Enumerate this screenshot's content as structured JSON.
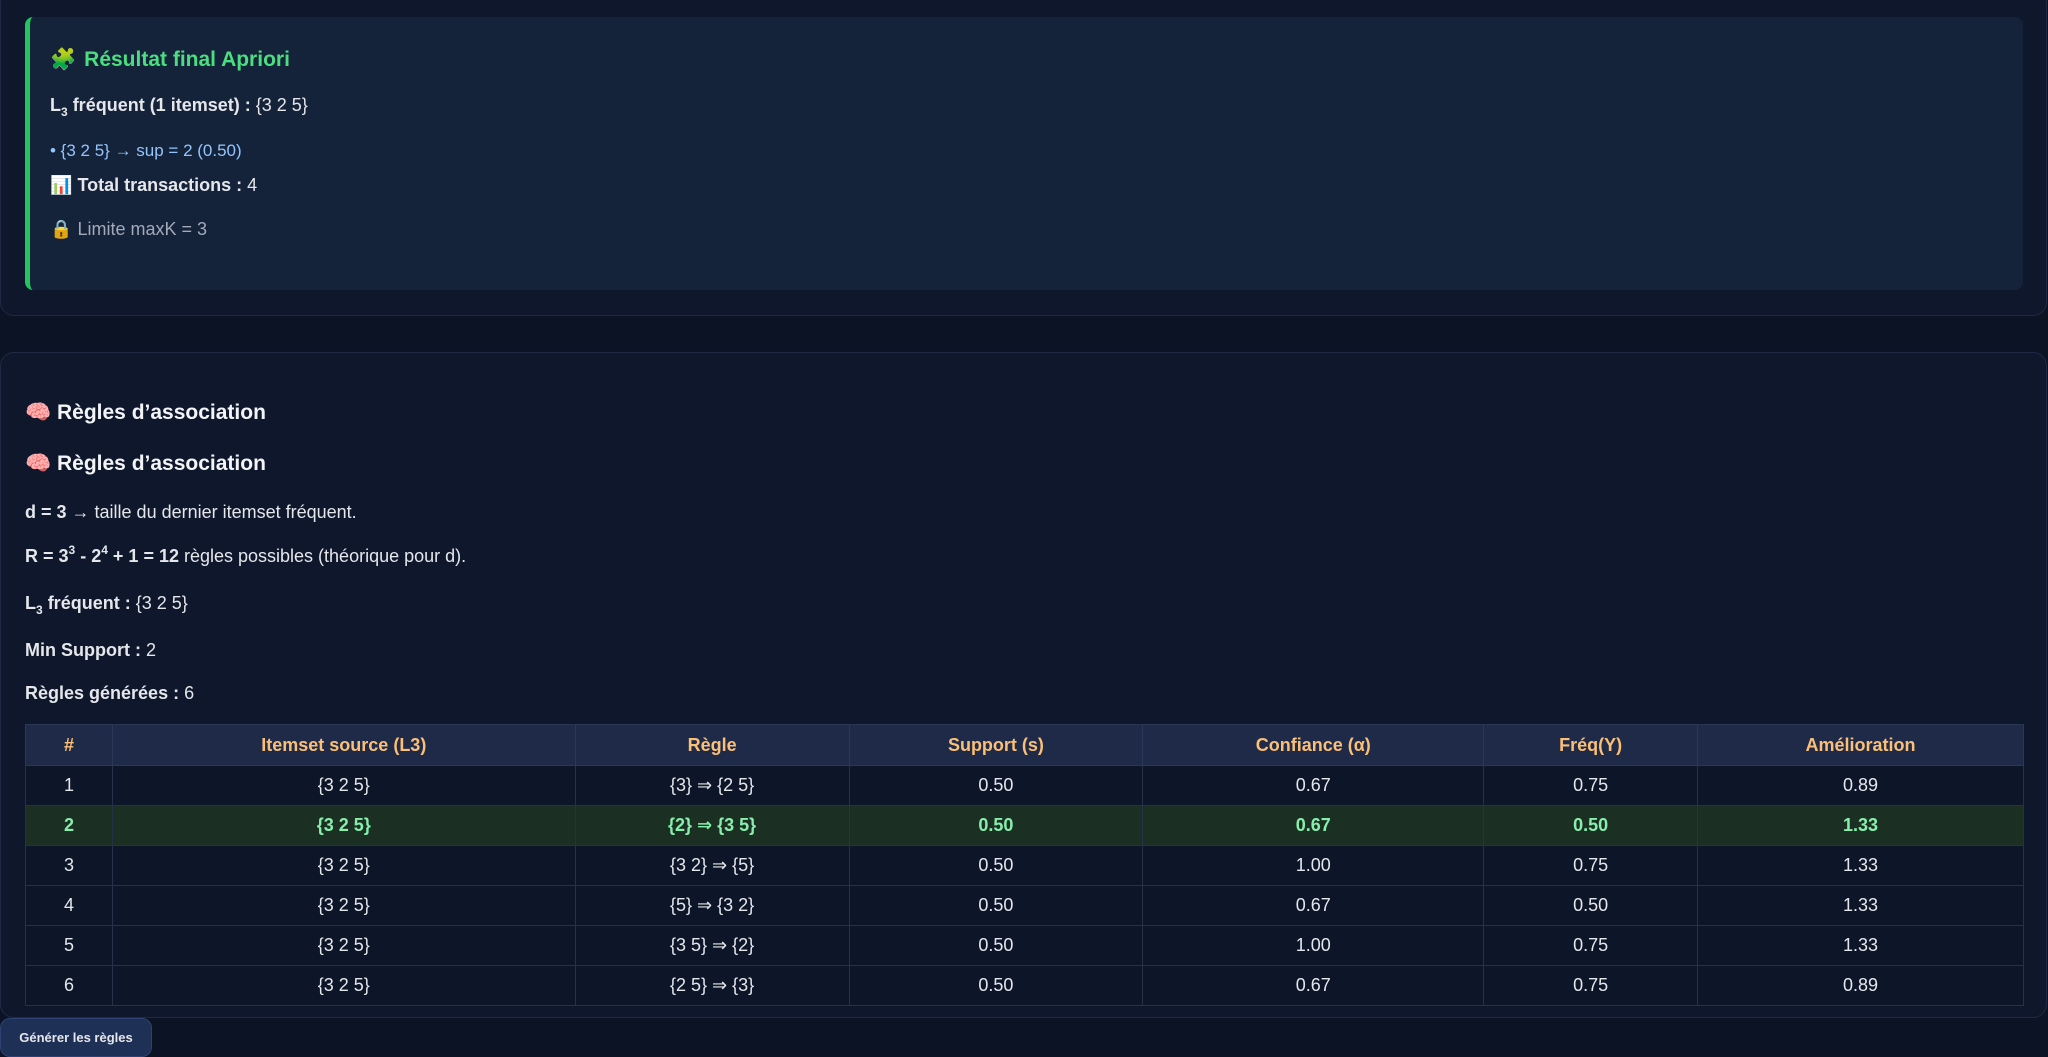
{
  "result": {
    "title_icon": "🧩",
    "title": "Résultat final Apriori",
    "l3_prefix": "L",
    "l3_sub": "3",
    "l3_label": " fréquent (1 itemset) :",
    "l3_value": " {3 2 5}",
    "bullet": "• {3 2 5} → sup = 2 (0.50)",
    "total_icon": "📊",
    "total_label": "Total transactions :",
    "total_value": " 4",
    "limit_icon": "🔒",
    "limit_text": "Limite maxK = 3"
  },
  "rules": {
    "heading_icon": "🧠",
    "heading": "Règles d’association",
    "heading2": "Règles d’association",
    "d_label": "d = 3",
    "d_text": " → taille du dernier itemset fréquent.",
    "r_label_a": "R = 3",
    "r_sup1": "3",
    "r_label_b": " - 2",
    "r_sup2": "4",
    "r_label_c": " + 1 = 12",
    "r_text": " règles possibles (théorique pour d).",
    "l3_prefix": "L",
    "l3_sub": "3",
    "l3_label": " fréquent :",
    "l3_value": " {3 2 5}",
    "minsup_label": "Min Support :",
    "minsup_value": " 2",
    "generated_label": "Règles générées :",
    "generated_value": " 6",
    "table": {
      "headers": [
        "#",
        "Itemset source (L3)",
        "Règle",
        "Support (s)",
        "Confiance (α)",
        "Fréq(Y)",
        "Amélioration"
      ],
      "rows": [
        [
          "1",
          "{3 2 5}",
          "{3} ⇒ {2 5}",
          "0.50",
          "0.67",
          "0.75",
          "0.89"
        ],
        [
          "2",
          "{3 2 5}",
          "{2} ⇒ {3 5}",
          "0.50",
          "0.67",
          "0.50",
          "1.33"
        ],
        [
          "3",
          "{3 2 5}",
          "{3 2} ⇒ {5}",
          "0.50",
          "1.00",
          "0.75",
          "1.33"
        ],
        [
          "4",
          "{3 2 5}",
          "{5} ⇒ {3 2}",
          "0.50",
          "0.67",
          "0.50",
          "1.33"
        ],
        [
          "5",
          "{3 2 5}",
          "{3 5} ⇒ {2}",
          "0.50",
          "1.00",
          "0.75",
          "1.33"
        ],
        [
          "6",
          "{3 2 5}",
          "{2 5} ⇒ {3}",
          "0.50",
          "0.67",
          "0.75",
          "0.89"
        ]
      ]
    }
  },
  "generate_button": "Générer les règles"
}
